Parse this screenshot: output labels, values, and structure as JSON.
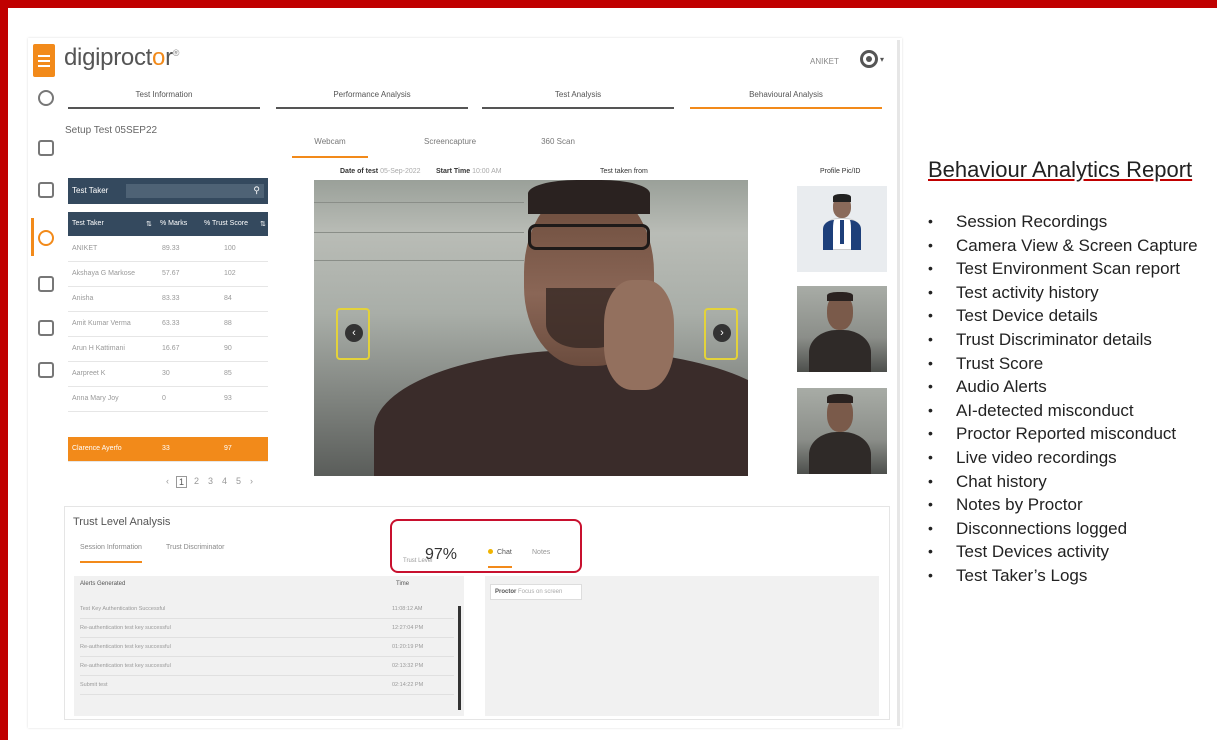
{
  "app": {
    "logo_main": "digiproct",
    "logo_o": "o",
    "logo_end": "r",
    "logo_mark": "®",
    "user_name": "ANIKET"
  },
  "main_tabs": [
    {
      "label": "Test Information",
      "active": false
    },
    {
      "label": "Performance Analysis",
      "active": false
    },
    {
      "label": "Test Analysis",
      "active": false
    },
    {
      "label": "Behavioural Analysis",
      "active": true
    }
  ],
  "setup_title": "Setup Test 05SEP22",
  "media_tabs": [
    {
      "label": "Webcam",
      "active": true
    },
    {
      "label": "Screencapture",
      "active": false
    },
    {
      "label": "360 Scan",
      "active": false
    }
  ],
  "meta": {
    "date_label": "Date of test",
    "date_value": "05-Sep-2022",
    "start_label": "Start Time",
    "start_value": "10:00 AM",
    "taken_from_label": "Test taken from",
    "profile_label": "Profile Pic/ID"
  },
  "test_takers": {
    "header_label": "Test Taker",
    "columns": [
      "Test Taker",
      "% Marks",
      "% Trust Score"
    ],
    "rows": [
      {
        "name": "ANIKET",
        "marks": "89.33",
        "trust": "100"
      },
      {
        "name": "Akshaya G Markose",
        "marks": "57.67",
        "trust": "102"
      },
      {
        "name": "Anisha",
        "marks": "83.33",
        "trust": "84"
      },
      {
        "name": "Amit Kumar Verma",
        "marks": "63.33",
        "trust": "88"
      },
      {
        "name": "Arun H Kattimani",
        "marks": "16.67",
        "trust": "90"
      },
      {
        "name": "Aarpreet K",
        "marks": "30",
        "trust": "85"
      },
      {
        "name": "Anna Mary Joy",
        "marks": "0",
        "trust": "93"
      },
      {
        "name": "Clarence Ayerfo",
        "marks": "33",
        "trust": "97",
        "selected": true
      }
    ],
    "pagination": [
      "‹",
      "1",
      "2",
      "3",
      "4",
      "5",
      "›"
    ]
  },
  "trust_level": {
    "title": "Trust Level Analysis",
    "tabs": [
      "Session Information",
      "Trust Discriminator"
    ],
    "label": "Trust Level",
    "value": "97%",
    "chat_tab": "Chat",
    "notes_tab": "Notes"
  },
  "alerts": {
    "col_alert": "Alerts Generated",
    "col_time": "Time",
    "rows": [
      {
        "alert": "Test Key Authentication Successful",
        "time": "11:08:12 AM"
      },
      {
        "alert": "Re-authentication test key successful",
        "time": "12:27:04 PM"
      },
      {
        "alert": "Re-authentication test key successful",
        "time": "01:20:19 PM"
      },
      {
        "alert": "Re-authentication test key successful",
        "time": "02:13:32 PM"
      },
      {
        "alert": "Submit test",
        "time": "02:14:22 PM"
      }
    ]
  },
  "chat": {
    "sender": "Proctor",
    "message": "Focus on screen"
  },
  "report": {
    "title": "Behaviour Analytics Report",
    "features": [
      "Session Recordings",
      "Camera View & Screen Capture",
      "Test Environment Scan report",
      "Test activity history",
      "Test Device details",
      "Trust Discriminator details",
      "Trust Score",
      "Audio Alerts",
      "AI-detected misconduct",
      "Proctor Reported misconduct",
      "Live video recordings",
      "Chat history",
      "Notes by Proctor",
      "Disconnections logged",
      "Test Devices activity",
      "Test Taker’s Logs"
    ]
  },
  "colors": {
    "accent": "#f28a1a",
    "frame": "#c00000",
    "table_header": "#34495e",
    "trust_highlight": "#c8102e"
  },
  "icons": [
    "menu-icon",
    "dashboard-icon",
    "test-icon",
    "edit-icon",
    "analytics-icon",
    "report-icon",
    "login-icon",
    "calendar-icon",
    "search-icon",
    "sort-icon",
    "user-avatar-icon",
    "prev-arrow-icon",
    "next-arrow-icon"
  ]
}
